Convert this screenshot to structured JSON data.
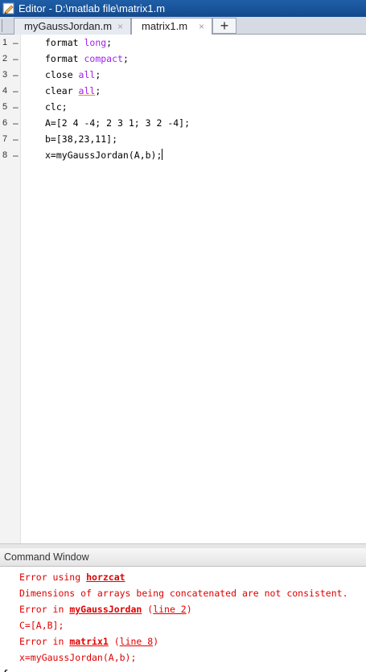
{
  "window": {
    "title": "Editor - D:\\matlab file\\matrix1.m"
  },
  "tabs": [
    {
      "label": "myGaussJordan.m",
      "active": false
    },
    {
      "label": "matrix1.m",
      "active": true
    }
  ],
  "tab_add_label": "+",
  "tab_close_glyph": "×",
  "editor": {
    "lines": [
      {
        "number": "1",
        "marker": "–",
        "parts": [
          {
            "t": "format ",
            "c": "plain"
          },
          {
            "t": "long",
            "c": "kw"
          },
          {
            "t": ";",
            "c": "plain"
          }
        ]
      },
      {
        "number": "2",
        "marker": "–",
        "parts": [
          {
            "t": "format ",
            "c": "plain"
          },
          {
            "t": "compact",
            "c": "kw"
          },
          {
            "t": ";",
            "c": "plain"
          }
        ]
      },
      {
        "number": "3",
        "marker": "–",
        "parts": [
          {
            "t": "close ",
            "c": "plain"
          },
          {
            "t": "all",
            "c": "kw"
          },
          {
            "t": ";",
            "c": "plain"
          }
        ]
      },
      {
        "number": "4",
        "marker": "–",
        "parts": [
          {
            "t": "clear ",
            "c": "plain"
          },
          {
            "t": "all",
            "c": "kw-warn"
          },
          {
            "t": ";",
            "c": "plain"
          }
        ]
      },
      {
        "number": "5",
        "marker": "–",
        "parts": [
          {
            "t": "clc;",
            "c": "plain"
          }
        ]
      },
      {
        "number": "6",
        "marker": "–",
        "parts": [
          {
            "t": "A=[2 4 -4; 2 3 1; 3 2 -4];",
            "c": "plain"
          }
        ]
      },
      {
        "number": "7",
        "marker": "–",
        "parts": [
          {
            "t": "b=[38,23,11];",
            "c": "plain"
          }
        ]
      },
      {
        "number": "8",
        "marker": "–",
        "parts": [
          {
            "t": "x=myGaussJordan(A,b);",
            "c": "plain"
          }
        ]
      }
    ]
  },
  "command_window": {
    "title": "Command Window",
    "lines": [
      [
        {
          "t": "Error using ",
          "s": "plain"
        },
        {
          "t": "horzcat",
          "s": "link-bold"
        }
      ],
      [
        {
          "t": "Dimensions of arrays being concatenated are not consistent.",
          "s": "plain"
        }
      ],
      [
        {
          "t": "Error in ",
          "s": "plain"
        },
        {
          "t": "myGaussJordan",
          "s": "link-bold"
        },
        {
          "t": " (",
          "s": "plain"
        },
        {
          "t": "line 2",
          "s": "link"
        },
        {
          "t": ")",
          "s": "plain"
        }
      ],
      [
        {
          "t": "C=[A,B];",
          "s": "plain"
        }
      ],
      [
        {
          "t": "Error in ",
          "s": "plain"
        },
        {
          "t": "matrix1",
          "s": "link-bold"
        },
        {
          "t": " (",
          "s": "plain"
        },
        {
          "t": "line 8",
          "s": "link"
        },
        {
          "t": ")",
          "s": "plain"
        }
      ],
      [
        {
          "t": "x=myGaussJordan(A,b);",
          "s": "plain"
        }
      ]
    ],
    "fx_label": "fx",
    "prompt": ">>"
  },
  "colors": {
    "error_text": "#e00000",
    "keyword": "#a020f0",
    "titlebar": "#1f5fa8"
  }
}
